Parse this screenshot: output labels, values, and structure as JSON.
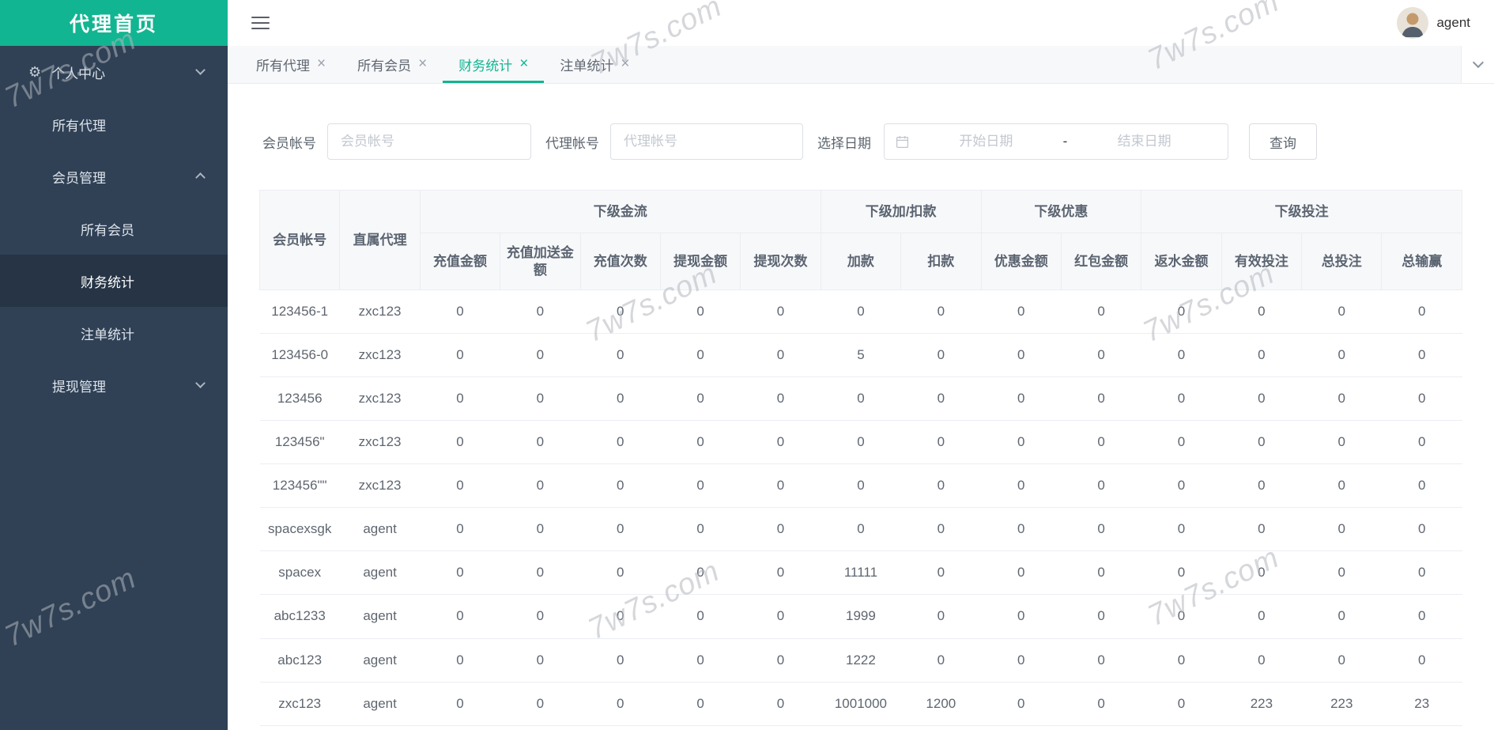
{
  "brand": {
    "title": "代理首页"
  },
  "header": {
    "username": "agent"
  },
  "watermark": {
    "text": "7w7s.com"
  },
  "sidebar": {
    "items": [
      {
        "name": "personal-center",
        "label": "个人中心",
        "level": 1,
        "icon": "gear-icon",
        "chevron": "down",
        "active": false
      },
      {
        "name": "all-agents",
        "label": "所有代理",
        "level": 2,
        "active": false
      },
      {
        "name": "member-management",
        "label": "会员管理",
        "level": 2,
        "chevron": "up",
        "active": false
      },
      {
        "name": "all-members",
        "label": "所有会员",
        "level": 3,
        "active": false
      },
      {
        "name": "finance-stats",
        "label": "财务统计",
        "level": 3,
        "active": true
      },
      {
        "name": "bet-stats",
        "label": "注单统计",
        "level": 3,
        "active": false
      },
      {
        "name": "withdrawal-management",
        "label": "提现管理",
        "level": 2,
        "chevron": "down",
        "active": false
      }
    ]
  },
  "tabs": [
    {
      "name": "all-agents",
      "label": "所有代理",
      "active": false
    },
    {
      "name": "all-members",
      "label": "所有会员",
      "active": false
    },
    {
      "name": "finance-stats",
      "label": "财务统计",
      "active": true
    },
    {
      "name": "bet-stats",
      "label": "注单统计",
      "active": false
    }
  ],
  "filters": {
    "member_label": "会员帐号",
    "member_placeholder": "会员帐号",
    "agent_label": "代理帐号",
    "agent_placeholder": "代理帐号",
    "date_label": "选择日期",
    "date_start_placeholder": "开始日期",
    "date_separator": "-",
    "date_end_placeholder": "结束日期",
    "search_button": "查询"
  },
  "table": {
    "fixed_headers": [
      "会员帐号",
      "直属代理"
    ],
    "groups": [
      {
        "label": "下级金流",
        "children": [
          "充值金额",
          "充值加送金额",
          "充值次数",
          "提现金额",
          "提现次数"
        ]
      },
      {
        "label": "下级加/扣款",
        "children": [
          "加款",
          "扣款"
        ]
      },
      {
        "label": "下级优惠",
        "children": [
          "优惠金额",
          "红包金额"
        ]
      },
      {
        "label": "下级投注",
        "children": [
          "返水金额",
          "有效投注",
          "总投注",
          "总输赢"
        ]
      }
    ],
    "rows": [
      [
        "123456-1",
        "zxc123",
        "0",
        "0",
        "0",
        "0",
        "0",
        "0",
        "0",
        "0",
        "0",
        "0",
        "0",
        "0",
        "0"
      ],
      [
        "123456-0",
        "zxc123",
        "0",
        "0",
        "0",
        "0",
        "0",
        "5",
        "0",
        "0",
        "0",
        "0",
        "0",
        "0",
        "0"
      ],
      [
        "123456",
        "zxc123",
        "0",
        "0",
        "0",
        "0",
        "0",
        "0",
        "0",
        "0",
        "0",
        "0",
        "0",
        "0",
        "0"
      ],
      [
        "123456\"",
        "zxc123",
        "0",
        "0",
        "0",
        "0",
        "0",
        "0",
        "0",
        "0",
        "0",
        "0",
        "0",
        "0",
        "0"
      ],
      [
        "123456\"\"",
        "zxc123",
        "0",
        "0",
        "0",
        "0",
        "0",
        "0",
        "0",
        "0",
        "0",
        "0",
        "0",
        "0",
        "0"
      ],
      [
        "spacexsgk",
        "agent",
        "0",
        "0",
        "0",
        "0",
        "0",
        "0",
        "0",
        "0",
        "0",
        "0",
        "0",
        "0",
        "0"
      ],
      [
        "spacex",
        "agent",
        "0",
        "0",
        "0",
        "0",
        "0",
        "11111",
        "0",
        "0",
        "0",
        "0",
        "0",
        "0",
        "0"
      ],
      [
        "abc1233",
        "agent",
        "0",
        "0",
        "0",
        "0",
        "0",
        "1999",
        "0",
        "0",
        "0",
        "0",
        "0",
        "0",
        "0"
      ],
      [
        "abc123",
        "agent",
        "0",
        "0",
        "0",
        "0",
        "0",
        "1222",
        "0",
        "0",
        "0",
        "0",
        "0",
        "0",
        "0"
      ],
      [
        "zxc123",
        "agent",
        "0",
        "0",
        "0",
        "0",
        "0",
        "1001000",
        "1200",
        "0",
        "0",
        "0",
        "223",
        "223",
        "23"
      ]
    ]
  }
}
